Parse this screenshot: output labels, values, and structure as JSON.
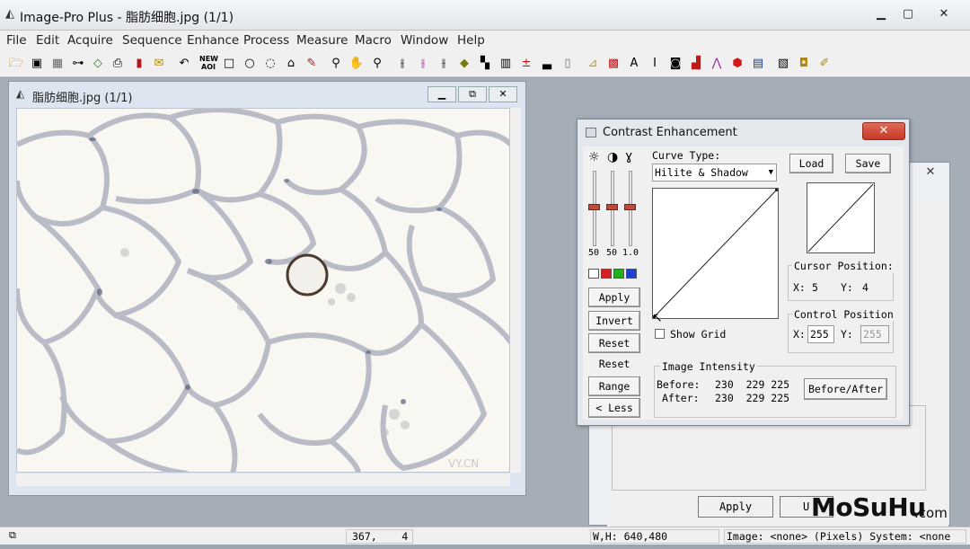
{
  "app": {
    "title": "Image-Pro Plus - 脂肪细胞.jpg (1/1)",
    "window_controls": [
      "▁",
      "▢",
      "✕"
    ]
  },
  "menu": [
    "File",
    "Edit",
    "Acquire",
    "Sequence",
    "Enhance",
    "Process",
    "Measure",
    "Macro",
    "Window",
    "Help"
  ],
  "toolbar_icons": [
    "open-folder-icon",
    "save-icon",
    "grid-icon",
    "capture-icon",
    "diamond-icon",
    "print-icon",
    "book-icon",
    "mail-icon",
    "undo-icon",
    "new-aoi-icon",
    "rectangle-tool-icon",
    "ellipse-tool-icon",
    "freehand-tool-icon",
    "magic-wand-icon",
    "pencil-icon",
    "zoom-icon",
    "hand-icon",
    "zoom-out-icon",
    "histogram-icon",
    "color-histogram-icon",
    "line-profile-icon",
    "fill-icon",
    "tiles-icon",
    "grid-bars-icon",
    "plus-minus-icon",
    "bars-icon",
    "strip-icon",
    "ruler-icon",
    "colorful-icon",
    "ai-icon",
    "ai2-icon",
    "camera-icon",
    "chart-icon",
    "graph-icon",
    "cube-icon",
    "spectrum-icon",
    "film-icon",
    "camera2-icon",
    "pencil2-icon"
  ],
  "toolbar_labels": {
    "new_aoi": "NEW\nAOI"
  },
  "image_window": {
    "title": "脂肪细胞.jpg (1/1)",
    "watermark": "VY.CN"
  },
  "contrast": {
    "title": "Contrast Enhancement",
    "curve_type_label": "Curve Type:",
    "curve_type_value": "Hilite & Shadow",
    "load": "Load",
    "save": "Save",
    "slider_values": [
      "50",
      "50",
      "1.0"
    ],
    "buttons": [
      "Apply",
      "Invert",
      "Reset",
      "Reset All",
      "Range",
      "< Less"
    ],
    "show_grid": "Show Grid",
    "cursor_position_label": "Cursor Position:",
    "cursor_x_label": "X:",
    "cursor_x": "5",
    "cursor_y_label": "Y:",
    "cursor_y": "4",
    "control_position_label": "Control Position",
    "control_x_label": "X:",
    "control_x": "255",
    "control_y_label": "Y:",
    "control_y": "255",
    "intensity_label": "Image Intensity",
    "before_label": "Before:",
    "before_values": "230  229 225",
    "after_label": "After:",
    "after_values": "230  229 225",
    "before_after_button": "Before/After"
  },
  "background_dialog": {
    "apply": "Apply",
    "undo_partial": "U"
  },
  "status": {
    "coords": "367,    4",
    "size": "W,H: 640,480",
    "image_info": "Image: <none> (Pixels) System: <none"
  },
  "watermark": {
    "brand": "MoSuHu",
    "suffix": ".com"
  }
}
